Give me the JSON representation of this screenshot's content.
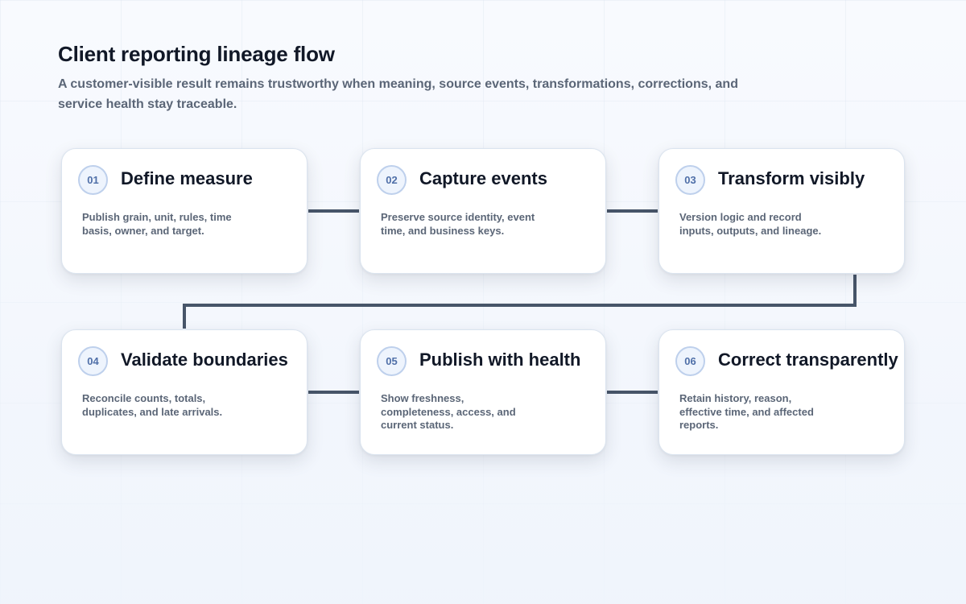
{
  "header": {
    "title": "Client reporting lineage flow",
    "subtitle": "A customer-visible result remains trustworthy when meaning, source events, transformations, corrections, and service health stay traceable."
  },
  "steps": [
    {
      "number": "01",
      "title": "Define measure",
      "description": "Publish grain, unit, rules, time basis, owner, and target."
    },
    {
      "number": "02",
      "title": "Capture events",
      "description": "Preserve source identity, event time, and business keys."
    },
    {
      "number": "03",
      "title": "Transform visibly",
      "description": "Version logic and record inputs, outputs, and lineage."
    },
    {
      "number": "04",
      "title": "Validate boundaries",
      "description": "Reconcile counts, totals, duplicates, and late arrivals."
    },
    {
      "number": "05",
      "title": "Publish with health",
      "description": "Show freshness, completeness, access, and current status."
    },
    {
      "number": "06",
      "title": "Correct transparently",
      "description": "Retain history, reason, effective time, and affected reports."
    }
  ],
  "colors": {
    "connector": "#475569",
    "badge_border": "#bed0ec",
    "badge_text": "#4f6fa8",
    "title_text": "#111827",
    "muted_text": "#5b6677"
  }
}
